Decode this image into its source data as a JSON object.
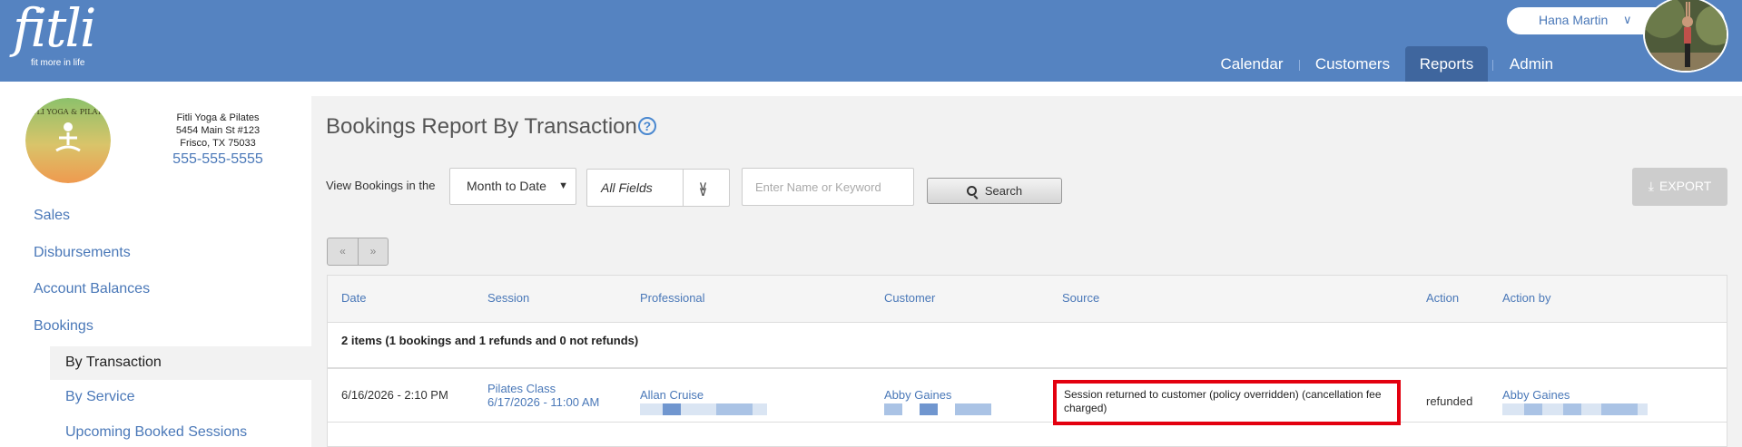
{
  "app": {
    "logo_text": "fitli",
    "tagline": "fit more in life",
    "user_name": "Hana Martin",
    "nav": [
      "Calendar",
      "Customers",
      "Reports",
      "Admin"
    ]
  },
  "studio": {
    "logo_text": "FITLI YOGA & PILATES",
    "name": "Fitli Yoga & Pilates",
    "address1": "5454 Main St #123",
    "address2": "Frisco, TX 75033",
    "phone": "555-555-5555"
  },
  "sidebar": {
    "items": [
      "Sales",
      "Disbursements",
      "Account Balances",
      "Bookings"
    ],
    "subitems": [
      "By Transaction",
      "By Service",
      "Upcoming Booked Sessions"
    ]
  },
  "report": {
    "title": "Bookings Report By Transaction",
    "help_glyph": "?",
    "filter_label": "View Bookings in the",
    "period": "Month to Date",
    "fields": "All Fields",
    "keyword_placeholder": "Enter Name or Keyword",
    "search_label": "Search",
    "export_label": "EXPORT",
    "pager_prev": "«",
    "pager_next": "»"
  },
  "table": {
    "columns": [
      "Date",
      "Session",
      "Professional",
      "Customer",
      "Source",
      "Action",
      "Action by"
    ],
    "summary": "2 items (1 bookings and 1 refunds and 0 not refunds)",
    "rows": [
      {
        "date": "6/16/2026 - 2:10 PM",
        "session_name": "Pilates Class",
        "session_time": "6/17/2026 - 11:00 AM",
        "professional": "Allan Cruise",
        "customer": "Abby Gaines",
        "source": "Session returned to customer (policy overridden) (cancellation fee charged)",
        "action": "refunded",
        "action_by": "Abby Gaines"
      }
    ]
  },
  "colors": {
    "header": "#5583c1",
    "nav_active": "#3f669e",
    "link": "#4a78b8",
    "highlight_border": "#e3000f"
  },
  "icons": [
    "avatar",
    "help-icon",
    "chevron-down-icon",
    "double-chevron-down-icon",
    "search-icon",
    "download-icon"
  ]
}
